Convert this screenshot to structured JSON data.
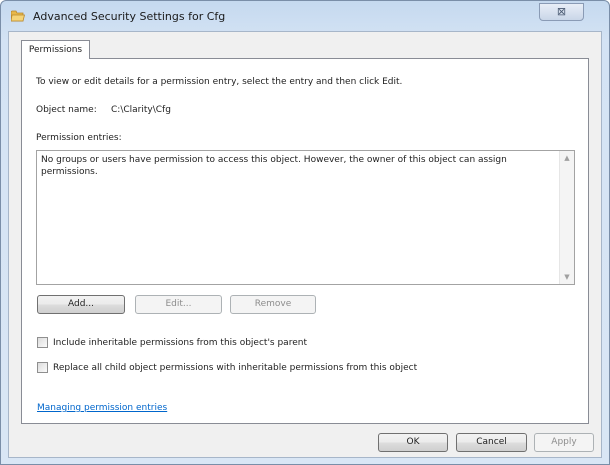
{
  "window": {
    "title": "Advanced Security Settings for Cfg",
    "close_glyph": "⊠"
  },
  "tab": {
    "label": "Permissions"
  },
  "panel": {
    "instructions": "To view or edit details for a permission entry, select the entry and then click Edit.",
    "object_name_label": "Object name:",
    "object_name_value": "C:\\Clarity\\Cfg",
    "entries_label": "Permission entries:",
    "entries_message": "No groups or users have permission to access this object. However, the owner of this object can assign permissions."
  },
  "entry_buttons": {
    "add": "Add...",
    "edit": "Edit...",
    "remove": "Remove"
  },
  "checkboxes": {
    "inherit": "Include inheritable permissions from this object's parent",
    "replace": "Replace all child object permissions with inheritable permissions from this object"
  },
  "help_link": "Managing permission entries",
  "dialog_buttons": {
    "ok": "OK",
    "cancel": "Cancel",
    "apply": "Apply"
  },
  "icons": {
    "folder": "folder-icon",
    "close": "close-icon",
    "scroll_up": "chevron-up-icon",
    "scroll_down": "chevron-down-icon"
  }
}
